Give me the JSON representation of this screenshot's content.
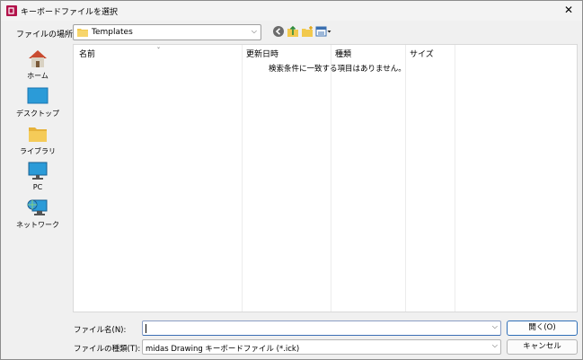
{
  "window": {
    "title": "キーボードファイルを選択",
    "close_glyph": "✕"
  },
  "toolbar": {
    "lookin_label": "ファイルの場所(I):",
    "lookin_value": "Templates",
    "icons": [
      "back-icon",
      "up-folder-icon",
      "new-folder-icon",
      "view-menu-icon"
    ]
  },
  "places": [
    {
      "name": "home",
      "label": "ホーム",
      "icon": "home-icon"
    },
    {
      "name": "desktop",
      "label": "デスクトップ",
      "icon": "desktop-icon"
    },
    {
      "name": "library",
      "label": "ライブラリ",
      "icon": "library-folder-icon"
    },
    {
      "name": "pc",
      "label": "PC",
      "icon": "pc-icon"
    },
    {
      "name": "network",
      "label": "ネットワーク",
      "icon": "network-icon"
    }
  ],
  "list": {
    "columns": [
      "名前",
      "更新日時",
      "種類",
      "サイズ"
    ],
    "empty_message": "検索条件に一致する項目はありません。"
  },
  "filename": {
    "label": "ファイル名(N):",
    "value": ""
  },
  "filetype": {
    "label": "ファイルの種類(T):",
    "value": "midas Drawing キーボードファイル (*.ick)"
  },
  "buttons": {
    "open": "開く(O)",
    "cancel": "キャンセル"
  },
  "colors": {
    "accent": "#2f6fb8",
    "brand": "#b3134b"
  }
}
